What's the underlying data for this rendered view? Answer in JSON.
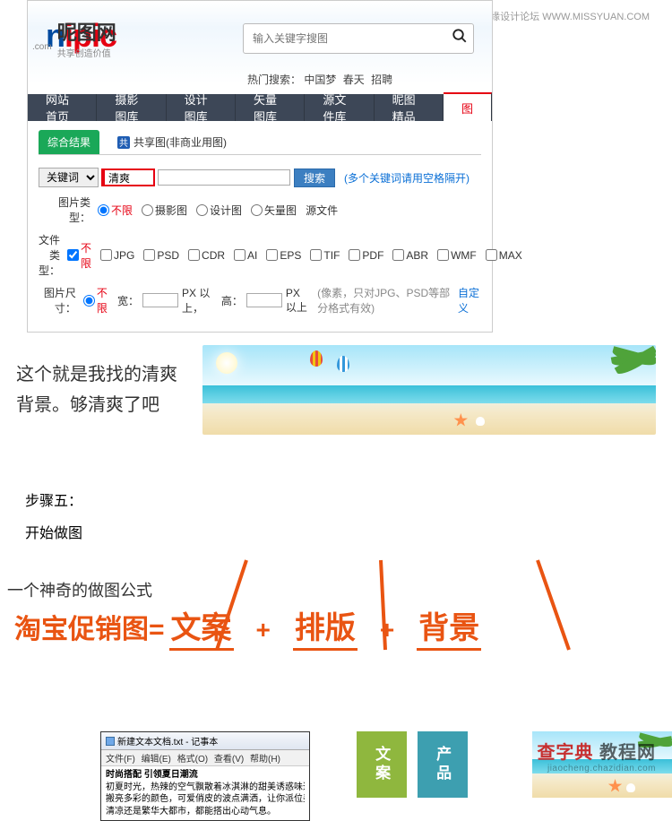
{
  "watermark_top": "思缘设计论坛  WWW.MISSYUAN.COM",
  "logo": {
    "text": "nipic",
    "com": ".com",
    "cn": "昵图网",
    "slogan": "共享创造价值"
  },
  "search": {
    "placeholder": "输入关键字搜图",
    "hot_label": "热门搜索：",
    "hot": [
      "中国梦",
      "春天",
      "招聘"
    ]
  },
  "nav": [
    "网站首页",
    "摄影图库",
    "设计图库",
    "矢量图库",
    "源文件库",
    "昵图精品",
    "图"
  ],
  "tabs": {
    "active": "综合结果",
    "share": "共享图(非商业用图)"
  },
  "filter": {
    "keyword_label": "关键词",
    "keyword_value": "清爽",
    "search_btn": "搜索",
    "hint": "(多个关键词请用空格隔开)",
    "pic_type_label": "图片类型：",
    "pic_types": [
      "不限",
      "摄影图",
      "设计图",
      "矢量图",
      "源文件"
    ],
    "file_type_label": "文件类型：",
    "file_types": [
      "不限",
      "JPG",
      "PSD",
      "CDR",
      "AI",
      "EPS",
      "TIF",
      "PDF",
      "ABR",
      "WMF",
      "MAX"
    ],
    "dim_label": "图片尺寸：",
    "dim_unlimited": "不限",
    "dim_w": "宽：",
    "dim_px1": "PX 以上，",
    "dim_h": "高：",
    "dim_px2": "PX 以上",
    "dim_hint": "(像素，只对JPG、PSD等部分格式有效)",
    "custom": "自定义"
  },
  "annotation": {
    "line1": "这个就是我找的清爽",
    "line2": "背景。够清爽了吧"
  },
  "step": {
    "t1": "步骤五：",
    "t2": "开始做图"
  },
  "formula": {
    "intro": "一个神奇的做图公式",
    "lhs": "淘宝促销图=",
    "t1": "文案",
    "plus": "+",
    "t2": "排版",
    "t3": "背景"
  },
  "notepad": {
    "title": "新建文本文档.txt - 记事本",
    "menu": [
      "文件(F)",
      "编辑(E)",
      "格式(O)",
      "查看(V)",
      "帮助(H)"
    ],
    "body": [
      "时尚搭配  引领夏日潮流",
      "初夏时光，热辣的空气飘散着冰淇淋的甜美诱惑味道",
      "搬亮多彩的颜色，可爱俏皮的波点满洒，让你派位美丽海滩。",
      "清凉还是繁华大都市，都能搭出心动气息。"
    ]
  },
  "blocks": {
    "a": "文案",
    "b": "产品"
  },
  "watermark_bottom": {
    "main_a": "查字典",
    "main_b": "教程网",
    "sub": "jiaocheng.chazidian.com"
  }
}
